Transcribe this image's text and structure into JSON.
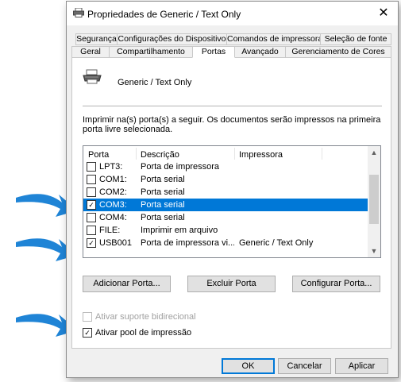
{
  "window": {
    "title": "Propriedades de Generic / Text Only",
    "close_glyph": "✕"
  },
  "tabs_row1": [
    "Segurança",
    "Configurações do Dispositivo",
    "Comandos de impressora",
    "Seleção de fonte"
  ],
  "tabs_row2": [
    "Geral",
    "Compartilhamento",
    "Portas",
    "Avançado",
    "Gerenciamento de Cores"
  ],
  "active_tab": "Portas",
  "printer": {
    "name": "Generic / Text Only",
    "icon": "printer-icon"
  },
  "description": "Imprimir na(s) porta(s) a seguir. Os documentos serão impressos na primeira porta livre selecionada.",
  "port_list": {
    "columns": [
      "Porta",
      "Descrição",
      "Impressora"
    ],
    "rows": [
      {
        "checked": false,
        "selected": false,
        "port": "LPT3:",
        "description": "Porta de impressora",
        "printer": ""
      },
      {
        "checked": false,
        "selected": false,
        "port": "COM1:",
        "description": "Porta serial",
        "printer": ""
      },
      {
        "checked": false,
        "selected": false,
        "port": "COM2:",
        "description": "Porta serial",
        "printer": ""
      },
      {
        "checked": true,
        "selected": true,
        "port": "COM3:",
        "description": "Porta serial",
        "printer": ""
      },
      {
        "checked": false,
        "selected": false,
        "port": "COM4:",
        "description": "Porta serial",
        "printer": ""
      },
      {
        "checked": false,
        "selected": false,
        "port": "FILE:",
        "description": "Imprimir em arquivo",
        "printer": ""
      },
      {
        "checked": true,
        "selected": false,
        "port": "USB001",
        "description": "Porta de impressora vi...",
        "printer": "Generic / Text Only"
      }
    ]
  },
  "buttons": {
    "add_port": "Adicionar Porta...",
    "delete_port": "Excluir Porta",
    "configure_port": "Configurar Porta..."
  },
  "options": {
    "bidirectional": {
      "label": "Ativar suporte bidirecional",
      "checked": false,
      "enabled": false
    },
    "pool": {
      "label": "Ativar pool de impressão",
      "checked": true,
      "enabled": true
    }
  },
  "footer": {
    "ok": "OK",
    "cancel": "Cancelar",
    "apply": "Aplicar"
  },
  "colors": {
    "selection": "#0078d7",
    "arrow": "#1f84d6",
    "dialog_bg": "#f0f0f0"
  }
}
